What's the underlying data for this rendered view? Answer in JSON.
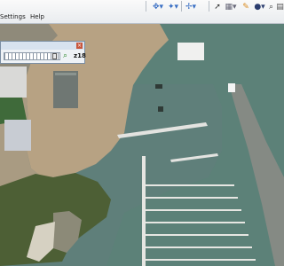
{
  "menu": {
    "items": [
      "Settings",
      "Help"
    ]
  },
  "toolbar": {
    "buttons": [
      {
        "icon": "navigate-arrows-icon",
        "glyph": "✥▾"
      },
      {
        "icon": "navigate-star-icon",
        "glyph": "✦▾"
      },
      {
        "icon": "navigate-move-icon",
        "glyph": "✢▾"
      },
      {
        "icon": "pointer-arrow-icon",
        "glyph": "➚"
      },
      {
        "icon": "select-box-icon",
        "glyph": "▦▾"
      },
      {
        "icon": "pencil-icon",
        "glyph": "✎"
      },
      {
        "icon": "globe-icon",
        "glyph": "●▾"
      },
      {
        "icon": "search-icon",
        "glyph": "⌕"
      },
      {
        "icon": "layers-icon",
        "glyph": "▤"
      }
    ]
  },
  "zoom_panel": {
    "level_label": "z18",
    "slider_fraction": 0.95
  },
  "colors": {
    "sea": "#5f7f7a",
    "land": "#b7a283",
    "vegetation": "#4d5f35",
    "pier": "#e3e3e0"
  }
}
